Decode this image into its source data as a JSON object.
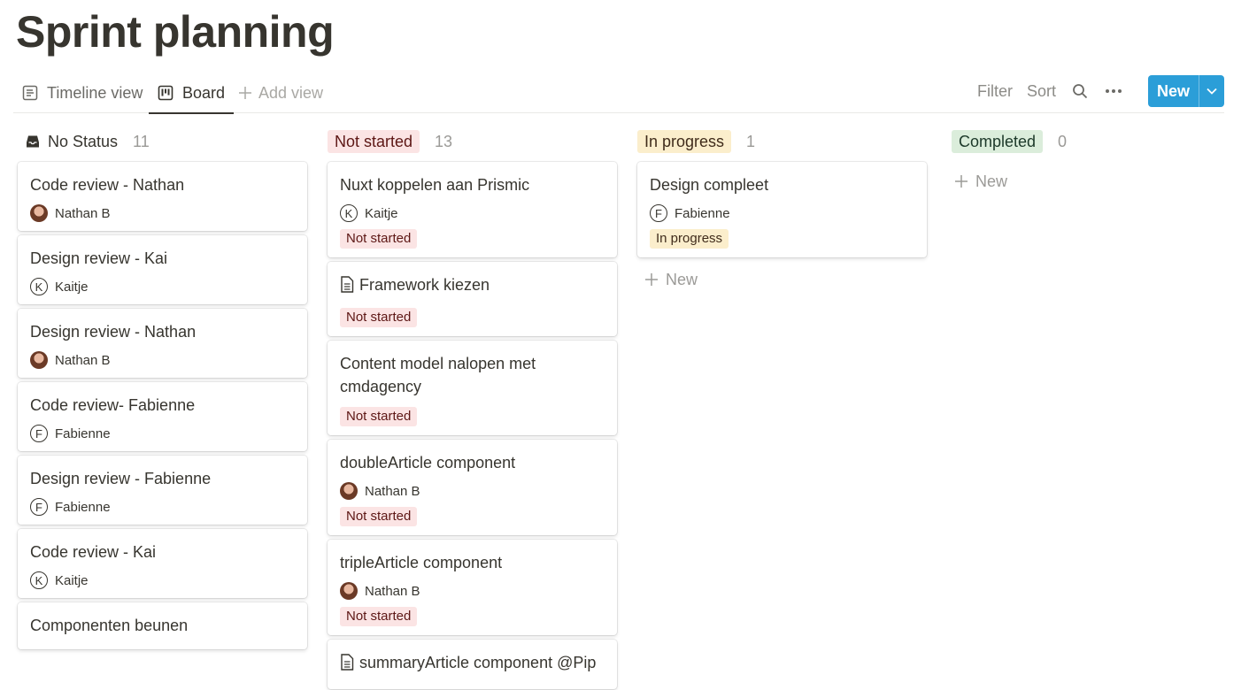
{
  "page": {
    "title": "Sprint planning"
  },
  "views": [
    {
      "label": "Timeline view",
      "icon": "timeline-icon"
    },
    {
      "label": "Board",
      "icon": "board-icon"
    },
    {
      "label": "Add view",
      "icon": "plus-icon"
    }
  ],
  "toolbar": {
    "filter": "Filter",
    "sort": "Sort",
    "new": "New"
  },
  "columns": [
    {
      "name": "No Status",
      "count": "11",
      "cards": [
        {
          "title": "Code review - Nathan",
          "person": "Nathan B"
        },
        {
          "title": "Design review - Kai",
          "person": "Kaitje",
          "initial": "K"
        },
        {
          "title": "Design review - Nathan",
          "person": "Nathan B"
        },
        {
          "title": "Code review- Fabienne",
          "person": "Fabienne",
          "initial": "F"
        },
        {
          "title": "Design review - Fabienne",
          "person": "Fabienne",
          "initial": "F"
        },
        {
          "title": "Code review - Kai",
          "person": "Kaitje",
          "initial": "K"
        },
        {
          "title": "Componenten beunen"
        }
      ]
    },
    {
      "name": "Not started",
      "count": "13",
      "cards": [
        {
          "title": "Nuxt koppelen aan Prismic",
          "person": "Kaitje",
          "initial": "K",
          "status": "Not started"
        },
        {
          "title": "Framework kiezen",
          "status": "Not started"
        },
        {
          "title": "Content model nalopen met cmdagency",
          "status": "Not started"
        },
        {
          "title": "doubleArticle component",
          "person": "Nathan B",
          "status": "Not started"
        },
        {
          "title": "tripleArticle component",
          "person": "Nathan B",
          "status": "Not started"
        },
        {
          "title": "summaryArticle component @Pip"
        }
      ]
    },
    {
      "name": "In progress",
      "count": "1",
      "cards": [
        {
          "title": "Design compleet",
          "person": "Fabienne",
          "initial": "F",
          "status": "In progress"
        }
      ],
      "new_label": "New"
    },
    {
      "name": "Completed",
      "count": "0",
      "new_label": "New"
    }
  ],
  "colors": {
    "accent": "#2b9ed8",
    "red_tag": "#fbe4e4",
    "yellow_tag": "#fbeecc",
    "green_tag": "#dbeddb"
  }
}
